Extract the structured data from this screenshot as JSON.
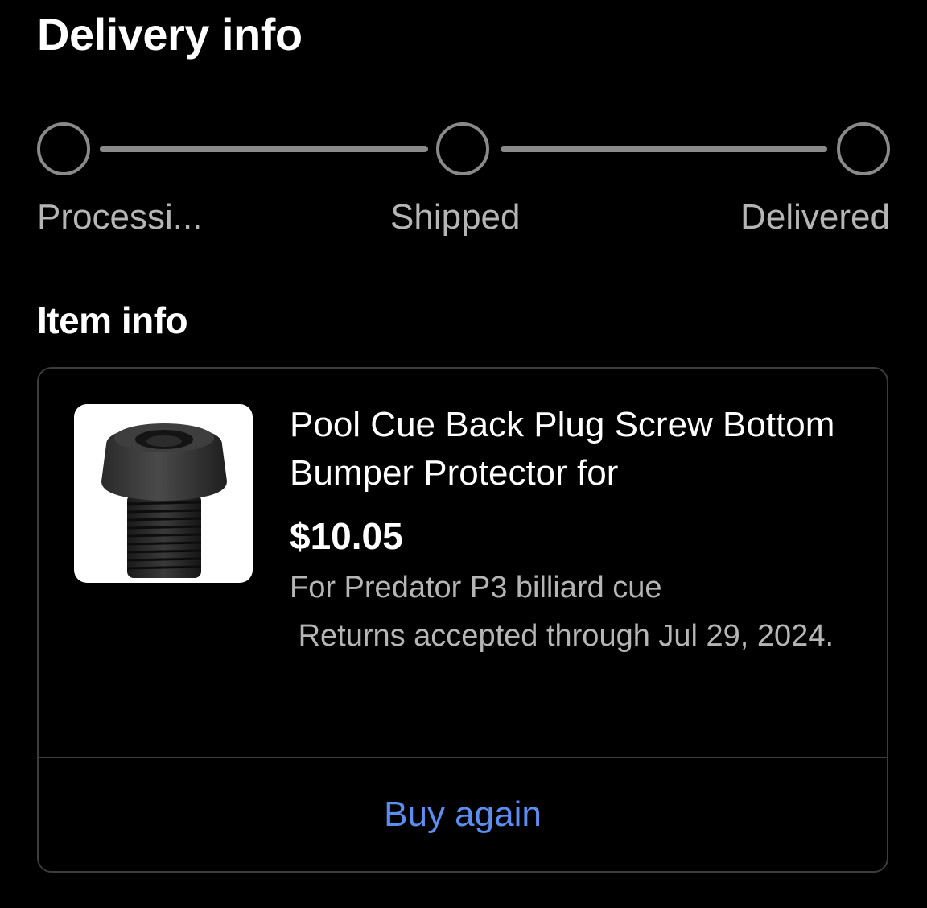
{
  "delivery": {
    "title": "Delivery info",
    "steps": [
      {
        "label": "Processi..."
      },
      {
        "label": "Shipped"
      },
      {
        "label": "Delivered"
      }
    ]
  },
  "item": {
    "title": "Item info",
    "name": "Pool Cue Back Plug Screw Bottom Bumper Protector for",
    "price": "$10.05",
    "variant": "For Predator P3 billiard cue",
    "returns": " Returns accepted through Jul 29, 2024.",
    "image": "pool-cue-back-plug-screw-image",
    "buy_again_label": "Buy again"
  },
  "colors": {
    "background": "#000000",
    "text": "#ffffff",
    "muted_text": "#b5b5b5",
    "step_gray": "#8a8a8a",
    "border": "#3c3c3c",
    "link": "#5b8ef0"
  }
}
